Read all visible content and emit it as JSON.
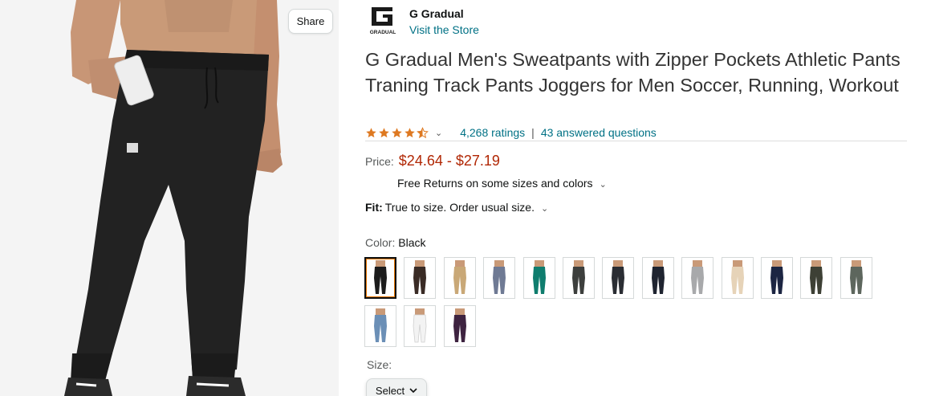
{
  "gallery": {
    "share_label": "Share"
  },
  "brand": {
    "logo_text": "GRADUAL",
    "name": "G Gradual",
    "store_link": "Visit the Store"
  },
  "product": {
    "title": "G Gradual Men's Sweatpants with Zipper Pockets Athletic Pants Traning Track Pants Joggers for Men Soccer, Running, Workout",
    "rating_value": 4.5,
    "ratings_text": "4,268 ratings",
    "separator": "|",
    "questions_text": "43 answered questions"
  },
  "price": {
    "label": "Price:",
    "value": "$24.64 - $27.19",
    "returns_text": "Free Returns on some sizes and colors"
  },
  "fit": {
    "label": "Fit:",
    "value": "True to size. Order usual size."
  },
  "color": {
    "label": "Color:",
    "selected": "Black",
    "swatches": [
      {
        "name": "Black",
        "hex": "#1c1c1c",
        "selected": true
      },
      {
        "name": "Brown",
        "hex": "#3a2b25"
      },
      {
        "name": "Khaki",
        "hex": "#c9a877"
      },
      {
        "name": "Blue Gray",
        "hex": "#6f7a94"
      },
      {
        "name": "Teal",
        "hex": "#0f7d6e"
      },
      {
        "name": "Dark Gray",
        "hex": "#3d3f3d"
      },
      {
        "name": "Charcoal",
        "hex": "#2a2d33"
      },
      {
        "name": "Navy Dark",
        "hex": "#1f2430"
      },
      {
        "name": "Light Gray",
        "hex": "#a8a9ab"
      },
      {
        "name": "Beige",
        "hex": "#e6d3b8"
      },
      {
        "name": "Navy",
        "hex": "#1c2542"
      },
      {
        "name": "Olive",
        "hex": "#3d4035"
      },
      {
        "name": "Sage",
        "hex": "#5d665d"
      },
      {
        "name": "Sky Blue",
        "hex": "#6b8fb6"
      },
      {
        "name": "White",
        "hex": "#f3f3f3"
      },
      {
        "name": "Purple",
        "hex": "#3e2340"
      }
    ]
  },
  "size": {
    "label": "Size:",
    "select_label": "Select"
  },
  "colors": {
    "link": "#007185",
    "price": "#b12704",
    "star": "#de7921"
  },
  "icons": {
    "rating": "star-icon",
    "dropdown": "chevron-down-icon"
  }
}
